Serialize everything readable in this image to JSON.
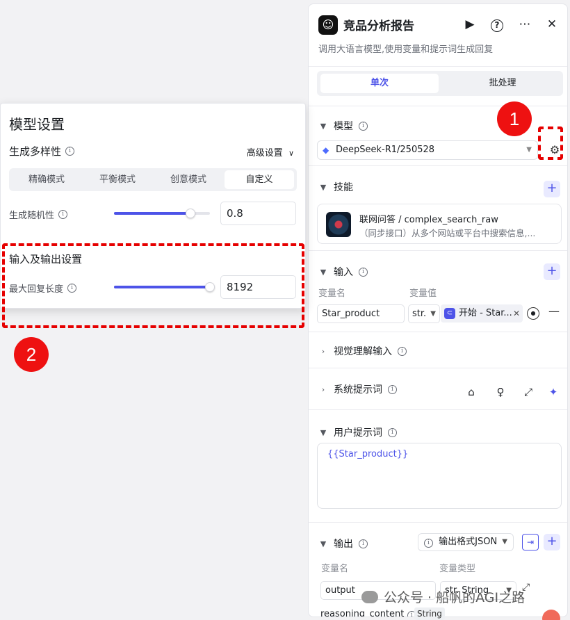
{
  "node": {
    "title": "竞品分析报告",
    "description": "调用大语言模型,使用变量和提示词生成回复",
    "logo_icon": "ghost-icon"
  },
  "header_buttons": [
    "play-icon",
    "help-icon",
    "more-icon",
    "close-icon"
  ],
  "tabs": [
    {
      "label": "单次",
      "active": true
    },
    {
      "label": "批处理",
      "active": false
    }
  ],
  "model_section": {
    "title": "模型",
    "selected_model": "DeepSeek-R1/250528"
  },
  "skills_section": {
    "title": "技能",
    "skill": {
      "name": "联网问答 / complex_search_raw",
      "description": "（同步接口）从多个网站或平台中搜索信息,..."
    }
  },
  "input_section": {
    "title": "输入",
    "col_name": "变量名",
    "col_value": "变量值",
    "var_name": "Star_product",
    "var_type": "str.",
    "ref_label": "开始 - Star..."
  },
  "vision_section": {
    "title": "视觉理解输入"
  },
  "system_prompt_section": {
    "title": "系统提示词"
  },
  "user_prompt_section": {
    "title": "用户提示词",
    "content": "{{Star_product}}"
  },
  "output_section": {
    "title": "输出",
    "format": "输出格式JSON",
    "col_name": "变量名",
    "col_type": "变量类型",
    "var_name": "output",
    "var_type": "str. String",
    "reasoning_label": "reasoning_content",
    "reasoning_type": "String"
  },
  "model_settings": {
    "title": "模型设置",
    "diversity_label": "生成多样性",
    "advanced_label": "高级设置",
    "modes": [
      {
        "label": "精确模式",
        "active": false
      },
      {
        "label": "平衡模式",
        "active": false
      },
      {
        "label": "创意模式",
        "active": false
      },
      {
        "label": "自定义",
        "active": true
      }
    ],
    "temperature_label": "生成随机性",
    "temperature_value": "0.8",
    "temperature_fraction": 0.8,
    "io_title": "输入及输出设置",
    "max_length_label": "最大回复长度",
    "max_length_value": "8192",
    "max_length_fraction": 1.0
  },
  "annotations": {
    "marker_1": "1",
    "marker_2": "2",
    "color": "#e60000"
  },
  "watermark": "公众号 · 船帆的AGI之路",
  "colors": {
    "accent": "#4d53e8",
    "accent_light": "#e9eaff"
  }
}
